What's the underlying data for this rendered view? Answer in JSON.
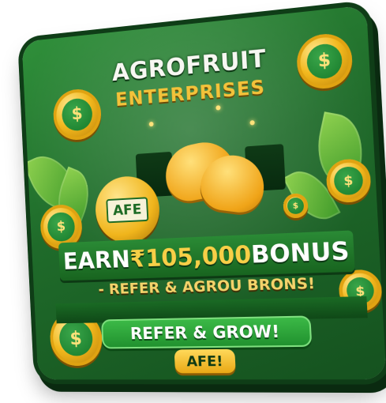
{
  "card": {
    "title": "AGROFRUIT",
    "subtitle": "ENTERPRISES"
  },
  "badge": {
    "label": "AFE"
  },
  "offer": {
    "prefix": "EARN ",
    "amount": "₹105,000",
    "suffix": " BONUS"
  },
  "tagline": "- REFER & AGROU BRONS!",
  "cta": {
    "button_label": "REFER & GROW!",
    "pill_label": "AFE!"
  },
  "coin_symbol": "$",
  "colors": {
    "card_green": "#1f6b2a",
    "gold": "#f2b81d",
    "leaf_green": "#8fd14f"
  }
}
